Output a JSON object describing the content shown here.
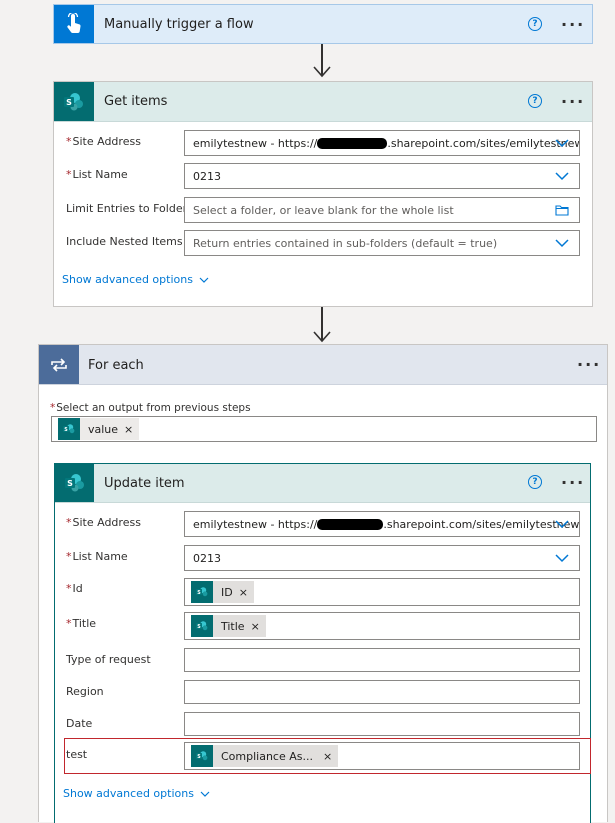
{
  "trigger": {
    "title": "Manually trigger a flow",
    "help": "?",
    "more": "···",
    "color": "#0078d4"
  },
  "get_items": {
    "title": "Get items",
    "help": "?",
    "more": "···",
    "site_address": {
      "label": "Site Address",
      "value_prefix": "emilytestnew - https://",
      "value_suffix": ".sharepoint.com/sites/emilytestnew"
    },
    "list_name": {
      "label": "List Name",
      "value": "0213"
    },
    "limit_folder": {
      "label": "Limit Entries to Folder",
      "placeholder": "Select a folder, or leave blank for the whole list"
    },
    "nested_items": {
      "label": "Include Nested Items",
      "placeholder": "Return entries contained in sub-folders (default = true)"
    },
    "advanced": "Show advanced options"
  },
  "for_each": {
    "title": "For each",
    "more": "···",
    "output_label": "Select an output from previous steps",
    "token": "value",
    "color": "#4c6c9a"
  },
  "update_item": {
    "title": "Update item",
    "help": "?",
    "more": "···",
    "site_address": {
      "label": "Site Address",
      "value_prefix": "emilytestnew - https://",
      "value_suffix": ".sharepoint.com/sites/emilytestnew"
    },
    "list_name": {
      "label": "List Name",
      "value": "0213"
    },
    "id": {
      "label": "Id",
      "token": "ID"
    },
    "title_field": {
      "label": "Title",
      "token": "Title"
    },
    "type_of_request": {
      "label": "Type of request"
    },
    "region": {
      "label": "Region"
    },
    "date": {
      "label": "Date"
    },
    "test": {
      "label": "test",
      "token": "Compliance As..."
    },
    "advanced": "Show advanced options"
  },
  "token_close": "×",
  "sharepoint_color": "#036c70"
}
